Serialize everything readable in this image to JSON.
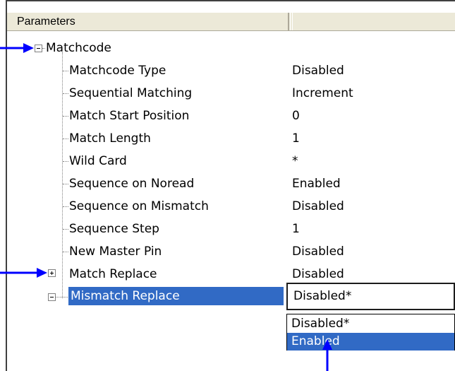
{
  "header": {
    "col1": "Parameters",
    "col2": ""
  },
  "root": {
    "label": "Matchcode",
    "expander": "minus"
  },
  "rows": [
    {
      "label": "Matchcode Type",
      "value": "Disabled"
    },
    {
      "label": "Sequential Matching",
      "value": "Increment"
    },
    {
      "label": "Match Start Position",
      "value": "0"
    },
    {
      "label": "Match Length",
      "value": "1"
    },
    {
      "label": "Wild Card",
      "value": " *"
    },
    {
      "label": "Sequence on Noread",
      "value": "Enabled"
    },
    {
      "label": "Sequence on Mismatch",
      "value": "Disabled"
    },
    {
      "label": "Sequence Step",
      "value": "1"
    },
    {
      "label": "New Master Pin",
      "value": "Disabled"
    },
    {
      "label": "Match Replace",
      "value": "Disabled",
      "expander": "plus"
    }
  ],
  "selected_row": {
    "label": "Mismatch Replace",
    "expander": "minus"
  },
  "combo": {
    "value": "Disabled*"
  },
  "dropdown": {
    "options": [
      "Disabled*",
      "Enabled"
    ],
    "selected_index": 1
  },
  "colors": {
    "selection": "#316ac5",
    "arrow": "#0000ff",
    "header_bg": "#ece9d8"
  },
  "icons": {
    "expand": "plus-box-icon",
    "collapse": "minus-box-icon"
  }
}
